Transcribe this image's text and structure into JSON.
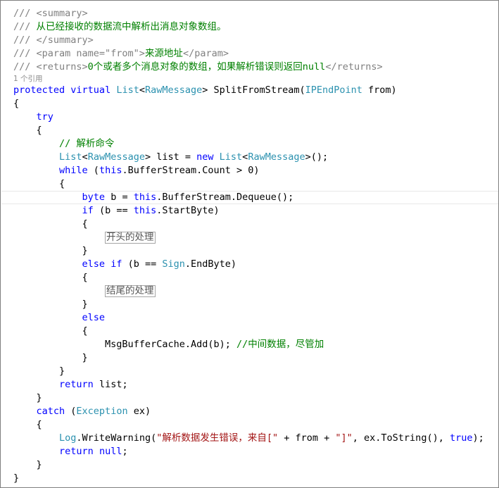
{
  "editor": {
    "codelens": "1 个引用",
    "lines": [
      [
        [
          "doc",
          "/// <summary>"
        ]
      ],
      [
        [
          "doc",
          "/// "
        ],
        [
          "comment",
          "从已经接收的数据流中解析出消息对象数组。"
        ]
      ],
      [
        [
          "doc",
          "/// </summary>"
        ]
      ],
      [
        [
          "doc",
          "/// <param name=\"from\">"
        ],
        [
          "comment",
          "来源地址"
        ],
        [
          "doc",
          "</param>"
        ]
      ],
      [
        [
          "doc",
          "/// <returns>"
        ],
        [
          "comment",
          "0个或者多个消息对象的数组，如果解析错误则返回null"
        ],
        [
          "doc",
          "</returns>"
        ]
      ],
      [
        [
          "kw",
          "protected"
        ],
        [
          "plain",
          " "
        ],
        [
          "kw",
          "virtual"
        ],
        [
          "plain",
          " "
        ],
        [
          "type",
          "List"
        ],
        [
          "plain",
          "<"
        ],
        [
          "type",
          "RawMessage"
        ],
        [
          "plain",
          "> SplitFromStream("
        ],
        [
          "type",
          "IPEndPoint"
        ],
        [
          "plain",
          " from)"
        ]
      ],
      [
        [
          "plain",
          "{"
        ]
      ],
      [
        [
          "plain",
          "    "
        ],
        [
          "kw",
          "try"
        ]
      ],
      [
        [
          "plain",
          "    {"
        ]
      ],
      [
        [
          "plain",
          "        "
        ],
        [
          "comment",
          "// 解析命令"
        ]
      ],
      [
        [
          "plain",
          "        "
        ],
        [
          "type",
          "List"
        ],
        [
          "plain",
          "<"
        ],
        [
          "type",
          "RawMessage"
        ],
        [
          "plain",
          "> list = "
        ],
        [
          "kw",
          "new"
        ],
        [
          "plain",
          " "
        ],
        [
          "type",
          "List"
        ],
        [
          "plain",
          "<"
        ],
        [
          "type",
          "RawMessage"
        ],
        [
          "plain",
          ">();"
        ]
      ],
      [
        [
          "plain",
          "        "
        ],
        [
          "kw",
          "while"
        ],
        [
          "plain",
          " ("
        ],
        [
          "kw",
          "this"
        ],
        [
          "plain",
          ".BufferStream.Count > 0)"
        ]
      ],
      [
        [
          "plain",
          "        {"
        ]
      ],
      [
        [
          "plain",
          "            "
        ],
        [
          "kw",
          "byte"
        ],
        [
          "plain",
          " b = "
        ],
        [
          "kw",
          "this"
        ],
        [
          "plain",
          ".BufferStream.Dequeue();"
        ]
      ],
      [
        [
          "plain",
          "            "
        ],
        [
          "kw",
          "if"
        ],
        [
          "plain",
          " (b == "
        ],
        [
          "kw",
          "this"
        ],
        [
          "plain",
          ".StartByte)"
        ]
      ],
      [
        [
          "plain",
          "            {"
        ]
      ],
      [
        [
          "plain",
          "                "
        ],
        [
          "collapsed",
          "开头的处理"
        ]
      ],
      [
        [
          "plain",
          "            }"
        ]
      ],
      [
        [
          "plain",
          "            "
        ],
        [
          "kw",
          "else"
        ],
        [
          "plain",
          " "
        ],
        [
          "kw",
          "if"
        ],
        [
          "plain",
          " (b == "
        ],
        [
          "type",
          "Sign"
        ],
        [
          "plain",
          ".EndByte)"
        ]
      ],
      [
        [
          "plain",
          "            {"
        ]
      ],
      [
        [
          "plain",
          "                "
        ],
        [
          "collapsed",
          "结尾的处理"
        ]
      ],
      [
        [
          "plain",
          "            }"
        ]
      ],
      [
        [
          "plain",
          "            "
        ],
        [
          "kw",
          "else"
        ]
      ],
      [
        [
          "plain",
          "            {"
        ]
      ],
      [
        [
          "plain",
          "                MsgBufferCache.Add(b); "
        ],
        [
          "comment",
          "//中间数据，尽管加"
        ]
      ],
      [
        [
          "plain",
          "            }"
        ]
      ],
      [
        [
          "plain",
          "        }"
        ]
      ],
      [
        [
          "plain",
          "        "
        ],
        [
          "kw",
          "return"
        ],
        [
          "plain",
          " list;"
        ]
      ],
      [
        [
          "plain",
          "    }"
        ]
      ],
      [
        [
          "plain",
          "    "
        ],
        [
          "kw",
          "catch"
        ],
        [
          "plain",
          " ("
        ],
        [
          "type",
          "Exception"
        ],
        [
          "plain",
          " ex)"
        ]
      ],
      [
        [
          "plain",
          "    {"
        ]
      ],
      [
        [
          "plain",
          "        "
        ],
        [
          "type",
          "Log"
        ],
        [
          "plain",
          ".WriteWarning("
        ],
        [
          "str",
          "\"解析数据发生错误，来自[\""
        ],
        [
          "plain",
          " + from + "
        ],
        [
          "str",
          "\"]\""
        ],
        [
          "plain",
          ", ex.ToString(), "
        ],
        [
          "kw",
          "true"
        ],
        [
          "plain",
          ");"
        ]
      ],
      [
        [
          "plain",
          "        "
        ],
        [
          "kw",
          "return"
        ],
        [
          "plain",
          " "
        ],
        [
          "kw",
          "null"
        ],
        [
          "plain",
          ";"
        ]
      ],
      [
        [
          "plain",
          "    }"
        ]
      ],
      [
        [
          "plain",
          "}"
        ]
      ]
    ]
  },
  "colors": {
    "comment": "#008000",
    "doc": "#808080",
    "keyword": "#0000ff",
    "type": "#2b91af",
    "string": "#a31515",
    "plain": "#000000"
  }
}
